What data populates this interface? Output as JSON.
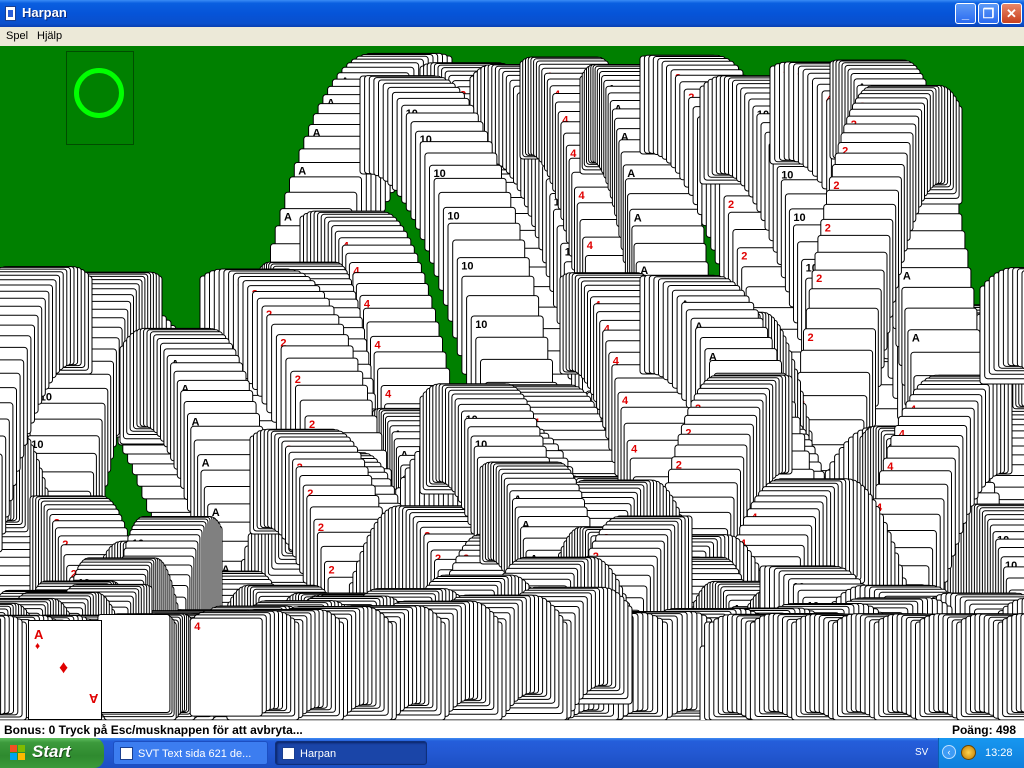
{
  "window": {
    "title": "Harpan",
    "minimize_glyph": "_",
    "maximize_glyph": "❐",
    "close_glyph": "✕"
  },
  "menu": [
    {
      "label": "Spel"
    },
    {
      "label": "Hjälp"
    }
  ],
  "game": {
    "felt_color": "#008000",
    "stock_ring_color": "#00ff00",
    "top_card": {
      "rank": "A",
      "suit": "♦",
      "color": "#e00000"
    }
  },
  "status": {
    "message": "Bonus: 0  Tryck på Esc/musknappen för att avbryta...",
    "score": "Poäng: 498"
  },
  "taskbar": {
    "start_label": "Start",
    "tasks": [
      {
        "label": "SVT Text sida 621 de..."
      },
      {
        "label": "Harpan"
      }
    ],
    "language": "SV",
    "clock": "13:28"
  }
}
